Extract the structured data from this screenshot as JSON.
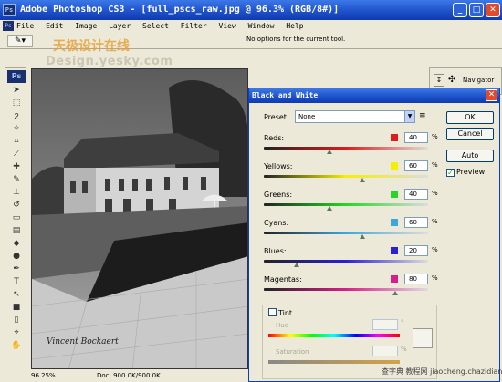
{
  "window": {
    "title": "Adobe Photoshop CS3 - [full_pscs_raw.jpg @ 96.3% (RGB/8#)]",
    "ps_logo": "Ps",
    "buttons": {
      "minimize": "_",
      "maximize": "□",
      "close": "✕"
    }
  },
  "menu": {
    "items": [
      "File",
      "Edit",
      "Image",
      "Layer",
      "Select",
      "Filter",
      "View",
      "Window",
      "Help"
    ]
  },
  "options_bar": {
    "tool_icon": "eyedropper-icon",
    "message": "No options for the current tool."
  },
  "watermark": {
    "line1": "天极设计在线",
    "line2": "Design.yesky.com"
  },
  "toolbox": {
    "logo": "Ps",
    "tools": [
      "move",
      "marquee",
      "lasso",
      "quick-select",
      "crop",
      "slice",
      "healing",
      "brush",
      "stamp",
      "history-brush",
      "eraser",
      "gradient",
      "blur",
      "dodge",
      "pen",
      "type",
      "path-select",
      "shape",
      "notes",
      "eyedropper",
      "hand"
    ]
  },
  "canvas": {
    "signature": "Vincent Bockaert"
  },
  "status_bar": {
    "zoom": "96.25%",
    "doc": "Doc: 900.0K/900.0K"
  },
  "right_panel": {
    "navigator_label": "Navigator"
  },
  "dialog": {
    "title": "Black and White",
    "close": "✕",
    "preset_label": "Preset:",
    "preset_value": "None",
    "preset_menu_icon": "≡",
    "buttons": {
      "ok": "OK",
      "cancel": "Cancel",
      "auto": "Auto"
    },
    "preview_label": "Preview",
    "preview_checked": true,
    "sliders": [
      {
        "label": "Reds:",
        "value": "40",
        "unit": "%",
        "color": "#dd1c1c",
        "level": 0.4
      },
      {
        "label": "Yellows:",
        "value": "60",
        "unit": "%",
        "color": "#f5ef00",
        "level": 0.6
      },
      {
        "label": "Greens:",
        "value": "40",
        "unit": "%",
        "color": "#27d627",
        "level": 0.4
      },
      {
        "label": "Cyans:",
        "value": "60",
        "unit": "%",
        "color": "#3ba8e0",
        "level": 0.6
      },
      {
        "label": "Blues:",
        "value": "20",
        "unit": "%",
        "color": "#2d1ed8",
        "level": 0.2
      },
      {
        "label": "Magentas:",
        "value": "80",
        "unit": "%",
        "color": "#d81e8c",
        "level": 0.8
      }
    ],
    "tint": {
      "label": "Tint",
      "checked": false,
      "hue_label": "Hue",
      "hue_unit": "°",
      "saturation_label": "Saturation",
      "saturation_unit": "%"
    }
  },
  "corner_watermark": "查字典 教程网 jiaocheng.chazidian.com"
}
